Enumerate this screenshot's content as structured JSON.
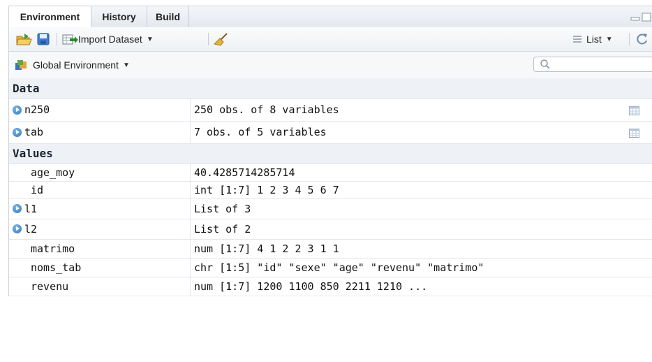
{
  "tabs": [
    {
      "label": "Environment",
      "active": true
    },
    {
      "label": "History",
      "active": false
    },
    {
      "label": "Build",
      "active": false
    }
  ],
  "toolbar": {
    "import_label": "Import Dataset",
    "view_label": "List",
    "icons": [
      "open-folder-icon",
      "save-icon",
      "import-icon",
      "broom-icon",
      "list-lines-icon",
      "refresh-icon"
    ]
  },
  "envbar": {
    "env_label": "Global Environment",
    "search_placeholder": ""
  },
  "sections": {
    "data_title": "Data",
    "values_title": "Values"
  },
  "data_rows": [
    {
      "name": "n250",
      "value": "250 obs. of 8 variables"
    },
    {
      "name": "tab",
      "value": "7 obs. of 5 variables"
    }
  ],
  "value_rows": [
    {
      "name": "age_moy",
      "value": "40.4285714285714"
    },
    {
      "name": "id",
      "value": "int [1:7] 1 2 3 4 5 6 7"
    },
    {
      "name": "l1",
      "value": "List of 3"
    },
    {
      "name": "l2",
      "value": "List of 2"
    },
    {
      "name": "matrimo",
      "value": "num [1:7] 4 1 2 2 3 1 1"
    },
    {
      "name": "noms_tab",
      "value": "chr [1:5] \"id\" \"sexe\" \"age\" \"revenu\" \"matrimo\""
    },
    {
      "name": "revenu",
      "value": "num [1:7] 1200 1100 850 2211 1210 ..."
    }
  ],
  "colors": {
    "accent": "#2f76b9",
    "header_bg": "#eef1f5"
  }
}
